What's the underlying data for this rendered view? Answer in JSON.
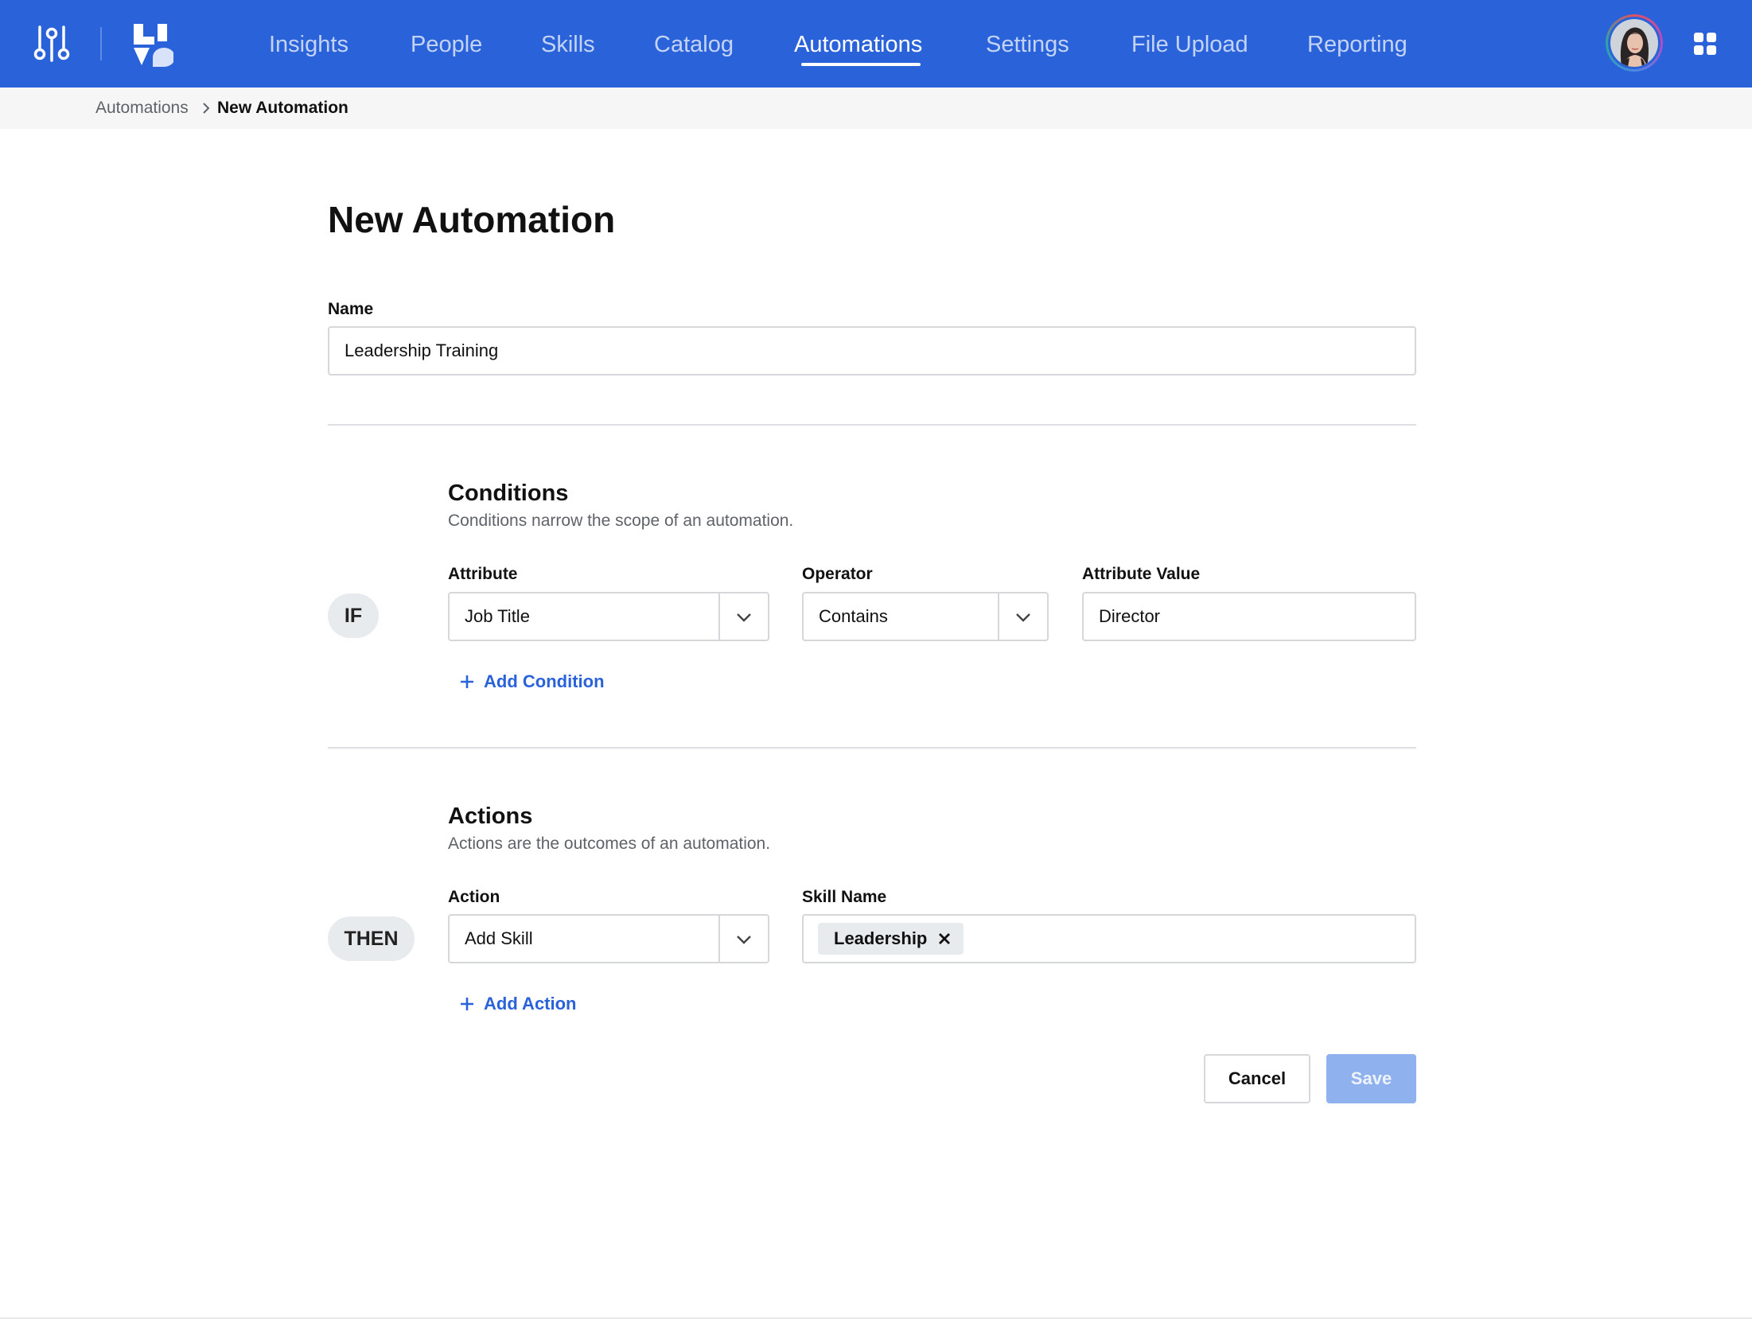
{
  "nav": {
    "items": [
      {
        "label": "Insights",
        "active": false
      },
      {
        "label": "People",
        "active": false
      },
      {
        "label": "Skills",
        "active": false
      },
      {
        "label": "Catalog",
        "active": false
      },
      {
        "label": "Automations",
        "active": true
      },
      {
        "label": "Settings",
        "active": false
      },
      {
        "label": "File Upload",
        "active": false
      },
      {
        "label": "Reporting",
        "active": false
      }
    ],
    "icons": {
      "left": "controls-sliders-icon",
      "logo": "brand-logo",
      "right": "apps-grid-icon"
    },
    "colors": {
      "bar": "#2a62d9",
      "active_text": "#ffffff"
    }
  },
  "breadcrumb": {
    "parent": "Automations",
    "current": "New Automation"
  },
  "page": {
    "title": "New Automation"
  },
  "name_field": {
    "label": "Name",
    "value": "Leadership Training"
  },
  "conditions": {
    "title": "Conditions",
    "description": "Conditions narrow the scope of an automation.",
    "keyword": "IF",
    "attribute": {
      "label": "Attribute",
      "value": "Job Title"
    },
    "operator": {
      "label": "Operator",
      "value": "Contains"
    },
    "attribute_value": {
      "label": "Attribute Value",
      "value": "Director"
    },
    "add_label": "Add Condition"
  },
  "actions": {
    "title": "Actions",
    "description": "Actions are the outcomes of an automation.",
    "keyword": "THEN",
    "action": {
      "label": "Action",
      "value": "Add Skill"
    },
    "skill_name": {
      "label": "Skill Name",
      "tags": [
        "Leadership"
      ]
    },
    "add_label": "Add Action"
  },
  "buttons": {
    "cancel": "Cancel",
    "save": "Save"
  },
  "colors": {
    "accent": "#2a62d9",
    "save_disabled": "#8fb1ee",
    "border": "#d5d7db"
  }
}
